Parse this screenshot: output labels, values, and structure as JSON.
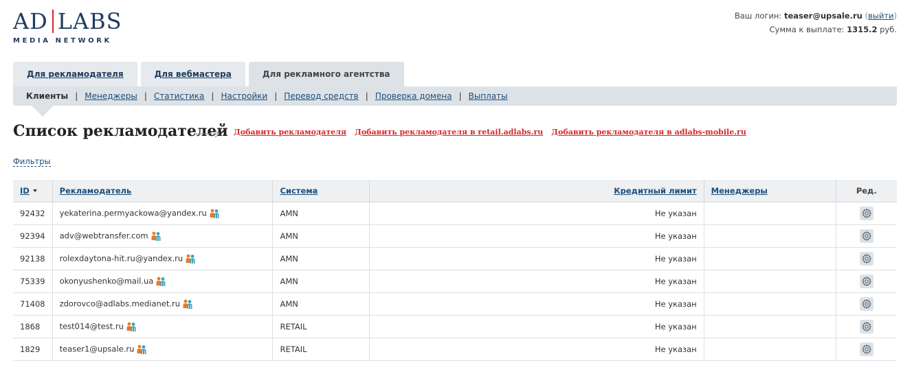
{
  "logo": {
    "left": "AD",
    "right": "LABS",
    "sub": "MEDIA NETWORK"
  },
  "account": {
    "login_label": "Ваш логин:",
    "login": "teaser@upsale.ru",
    "logout": "выйти",
    "payout_label": "Сумма к выплате:",
    "payout_amount": "1315.2",
    "payout_currency": "руб."
  },
  "tabs": [
    {
      "label": "Для рекламодателя",
      "active": false
    },
    {
      "label": "Для вебмастера",
      "active": false
    },
    {
      "label": "Для рекламного агентства",
      "active": true
    }
  ],
  "subnav": [
    {
      "label": "Клиенты",
      "current": true
    },
    {
      "label": "Менеджеры",
      "current": false
    },
    {
      "label": "Статистика",
      "current": false
    },
    {
      "label": "Настройки",
      "current": false
    },
    {
      "label": "Перевод средств",
      "current": false
    },
    {
      "label": "Проверка домена",
      "current": false
    },
    {
      "label": "Выплаты",
      "current": false
    }
  ],
  "page": {
    "title": "Список рекламодателей",
    "add_links": [
      "Добавить рекламодателя",
      "Добавить рекламодателя в retail.adlabs.ru",
      "Добавить рекламодателя в adlabs-mobile.ru"
    ],
    "filters": "Фильтры"
  },
  "table": {
    "headers": {
      "id": "ID",
      "advertiser": "Рекламодатель",
      "system": "Система",
      "credit_limit": "Кредитный лимит",
      "managers": "Менеджеры",
      "edit": "Ред."
    },
    "rows": [
      {
        "id": "92432",
        "advertiser": "yekaterina.permyackowa@yandex.ru",
        "system": "AMN",
        "credit_limit": "Не указан",
        "managers": ""
      },
      {
        "id": "92394",
        "advertiser": "adv@webtransfer.com",
        "system": "AMN",
        "credit_limit": "Не указан",
        "managers": ""
      },
      {
        "id": "92138",
        "advertiser": "rolexdaytona-hit.ru@yandex.ru",
        "system": "AMN",
        "credit_limit": "Не указан",
        "managers": ""
      },
      {
        "id": "75339",
        "advertiser": "okonyushenko@mail.ua",
        "system": "AMN",
        "credit_limit": "Не указан",
        "managers": ""
      },
      {
        "id": "71408",
        "advertiser": "zdorovco@adlabs.medianet.ru",
        "system": "AMN",
        "credit_limit": "Не указан",
        "managers": ""
      },
      {
        "id": "1868",
        "advertiser": "test014@test.ru",
        "system": "RETAIL",
        "credit_limit": "Не указан",
        "managers": ""
      },
      {
        "id": "1829",
        "advertiser": "teaser1@upsale.ru",
        "system": "RETAIL",
        "credit_limit": "Не указан",
        "managers": ""
      }
    ]
  },
  "icons": {
    "user": "users-icon",
    "edit": "gear-icon",
    "arrow": "arrow-right-icon"
  },
  "colors": {
    "brand": "#1e3a5f",
    "accent_red": "#d6262b",
    "link": "#1c4e7a",
    "nav_bg": "#dde2e7"
  }
}
